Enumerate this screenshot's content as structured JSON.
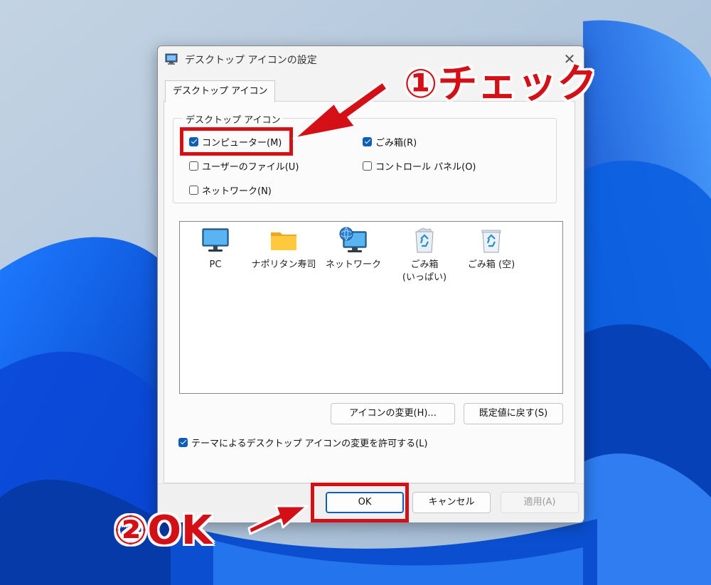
{
  "dialog": {
    "title": "デスクトップ アイコンの設定",
    "close_symbol": "✕",
    "tab_label": "デスクトップ アイコン",
    "group_label": "デスクトップ アイコン",
    "checkboxes": [
      {
        "label": "コンピューター(M)",
        "checked": true
      },
      {
        "label": "ごみ箱(R)",
        "checked": true
      },
      {
        "label": "ユーザーのファイル(U)",
        "checked": false
      },
      {
        "label": "コントロール パネル(O)",
        "checked": false
      },
      {
        "label": "ネットワーク(N)",
        "checked": false
      }
    ],
    "icons": [
      {
        "label": "PC",
        "icon": "monitor-icon"
      },
      {
        "label": "ナポリタン寿司",
        "icon": "folder-icon"
      },
      {
        "label": "ネットワーク",
        "icon": "network-icon"
      },
      {
        "label": "ごみ箱\n(いっぱい)",
        "icon": "recycle-bin-full-icon"
      },
      {
        "label": "ごみ箱 (空)",
        "icon": "recycle-bin-empty-icon"
      }
    ],
    "change_icon_button": "アイコンの変更(H)...",
    "restore_default_button": "既定値に戻す(S)",
    "theme_checkbox": {
      "label": "テーマによるデスクトップ アイコンの変更を許可する(L)",
      "checked": true
    },
    "ok_button": "OK",
    "cancel_button": "キャンセル",
    "apply_button": "適用(A)"
  },
  "annotations": {
    "step1": "①チェック",
    "step2": "②OK",
    "color": "#d40f16"
  },
  "colors": {
    "accent": "#0a5fb4",
    "wallpaper_blue": "#0b5fe0"
  }
}
